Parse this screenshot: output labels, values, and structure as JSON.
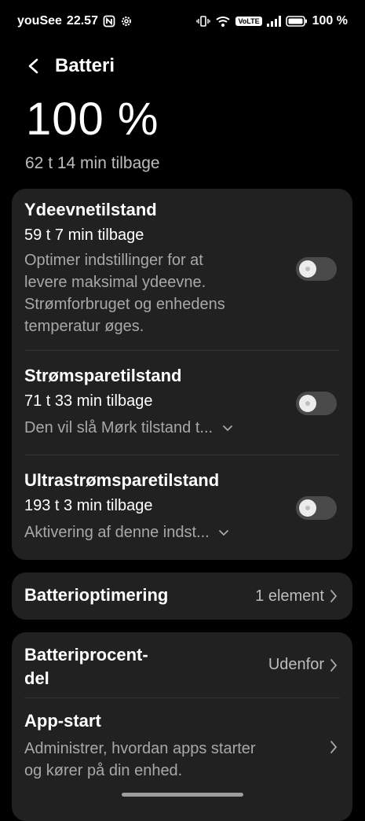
{
  "status_bar": {
    "carrier": "youSee",
    "time": "22.57",
    "volte": "VoLTE",
    "battery_pct": "100 %"
  },
  "header": {
    "title": "Batteri"
  },
  "battery": {
    "percent": "100 %",
    "remaining": "62 t 14 min tilbage"
  },
  "modes": {
    "performance": {
      "title": "Ydeevnetilstand",
      "remaining": "59 t 7 min tilbage",
      "desc": [
        "Optimer indstillinger for at",
        "levere maksimal ydeevne.",
        "Strømforbruget og enhedens",
        "temperatur øges."
      ],
      "enabled": false
    },
    "power_saving": {
      "title": "Strømsparetilstand",
      "remaining": "71 t 33 min tilbage",
      "desc": "Den vil slå Mørk tilstand t...",
      "enabled": false
    },
    "ultra_saving": {
      "title": "Ultrastrømsparetilstand",
      "remaining": "193 t 3 min tilbage",
      "desc": "Aktivering af denne indst...",
      "enabled": false
    }
  },
  "optimization": {
    "label": "Batterioptimering",
    "value": "1 element"
  },
  "settings": {
    "percent_display": {
      "label_line1": "Batteriprocent-",
      "label_line2": "del",
      "value": "Udenfor"
    },
    "app_start": {
      "label": "App-start",
      "desc": [
        "Administrer, hvordan apps starter",
        "og kører på din enhed."
      ]
    }
  }
}
